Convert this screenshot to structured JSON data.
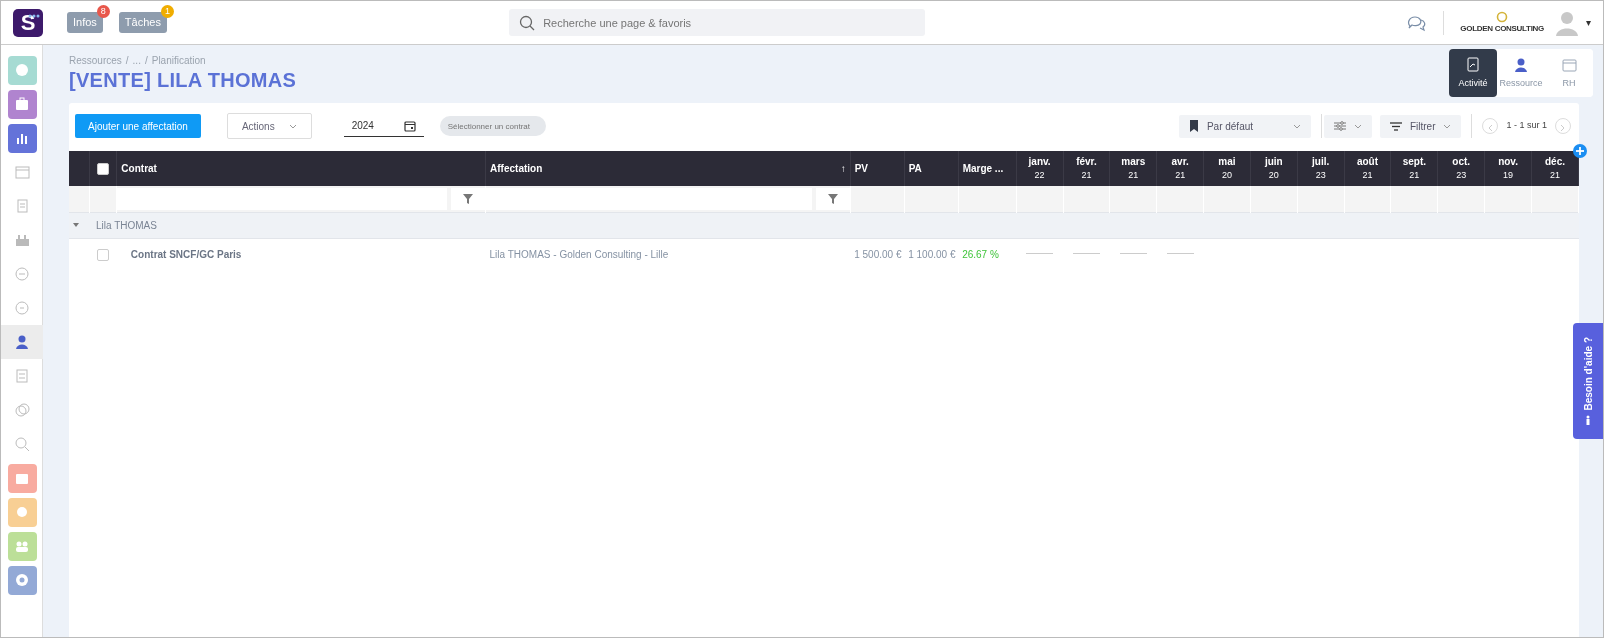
{
  "topbar": {
    "logo_text": "S",
    "badges": [
      {
        "label": "Infos",
        "count": "8",
        "color": "#e8574b"
      },
      {
        "label": "Tâches",
        "count": "1",
        "color": "#f0ad00"
      }
    ],
    "search": {
      "placeholder": "Recherche une page & favoris"
    },
    "company": "GOLDEN CONSULTING",
    "menu_caret": "▾"
  },
  "sidebar": {
    "items": [
      {
        "kind": "tile",
        "color": "#a6dbd3",
        "selected": false
      },
      {
        "kind": "tile",
        "color": "#b084cf",
        "selected": false
      },
      {
        "kind": "tile",
        "color": "#6473d9",
        "selected": false
      },
      {
        "kind": "plain",
        "selected": false
      },
      {
        "kind": "plain",
        "selected": false
      },
      {
        "kind": "plain",
        "selected": false
      },
      {
        "kind": "plain",
        "selected": false
      },
      {
        "kind": "plain",
        "selected": false
      },
      {
        "kind": "plain",
        "selected": true
      },
      {
        "kind": "plain",
        "selected": false
      },
      {
        "kind": "plain",
        "selected": false
      },
      {
        "kind": "plain",
        "selected": false
      },
      {
        "kind": "tile",
        "color": "#f8aba0",
        "selected": false
      },
      {
        "kind": "tile",
        "color": "#f8cf94",
        "selected": false
      },
      {
        "kind": "tile",
        "color": "#bcdf98",
        "selected": false
      },
      {
        "kind": "tile",
        "color": "#93a9d6",
        "selected": false
      }
    ]
  },
  "breadcrumb": [
    "Ressources",
    "/",
    "...",
    "/",
    "Planification"
  ],
  "title": "[VENTE] LILA THOMAS",
  "view_tabs": [
    {
      "label": "Activité",
      "selected": true
    },
    {
      "label": "Ressource",
      "selected": false
    },
    {
      "label": "RH",
      "selected": false
    }
  ],
  "toolbar": {
    "add_button": "Ajouter une affectation",
    "actions": "Actions",
    "year": "2024",
    "contract_select": {
      "placeholder": "Sélectionner un contrat"
    },
    "view_select": "Par défaut",
    "filter_button": "Filtrer",
    "pagination": "1 - 1 sur 1"
  },
  "table": {
    "all_checked": false,
    "columns": [
      {
        "kind": "text",
        "label": "Contrat",
        "filter": true
      },
      {
        "kind": "text",
        "label": "Affectation",
        "filter": true,
        "sort": "↑"
      },
      {
        "kind": "text",
        "label": "PV",
        "filter": false
      },
      {
        "kind": "text",
        "label": "PA",
        "filter": false
      },
      {
        "kind": "text",
        "label": "Marge ...",
        "filter": false
      },
      {
        "kind": "month",
        "label": "janv.",
        "days": "22",
        "filter": false
      },
      {
        "kind": "month",
        "label": "févr.",
        "days": "21",
        "filter": false
      },
      {
        "kind": "month",
        "label": "mars",
        "days": "21",
        "filter": false
      },
      {
        "kind": "month",
        "label": "avr.",
        "days": "21",
        "filter": false
      },
      {
        "kind": "month",
        "label": "mai",
        "days": "20",
        "filter": false
      },
      {
        "kind": "month",
        "label": "juin",
        "days": "20",
        "filter": false
      },
      {
        "kind": "month",
        "label": "juil.",
        "days": "23",
        "filter": false
      },
      {
        "kind": "month",
        "label": "août",
        "days": "21",
        "filter": false
      },
      {
        "kind": "month",
        "label": "sept.",
        "days": "21",
        "filter": false
      },
      {
        "kind": "month",
        "label": "oct.",
        "days": "23",
        "filter": false
      },
      {
        "kind": "month",
        "label": "nov.",
        "days": "19",
        "filter": false
      },
      {
        "kind": "month",
        "label": "déc.",
        "days": "21",
        "filter": false
      }
    ],
    "groups": [
      {
        "label": "Lila THOMAS",
        "expanded": true,
        "rows": [
          {
            "checked": false,
            "contrat": "Contrat SNCF/GC Paris",
            "affectation": "Lila THOMAS - Golden Consulting - Lille",
            "pv": "1 500.00 €",
            "pa": "1 100.00 €",
            "marge": "26.67 %",
            "months": [
              {
                "kind": "input"
              },
              {
                "kind": "input"
              },
              {
                "kind": "input"
              },
              {
                "kind": "input"
              },
              {
                "kind": "empty"
              },
              {
                "kind": "empty"
              },
              {
                "kind": "empty"
              },
              {
                "kind": "empty"
              },
              {
                "kind": "empty"
              },
              {
                "kind": "empty"
              },
              {
                "kind": "empty"
              },
              {
                "kind": "empty"
              }
            ]
          }
        ]
      }
    ]
  },
  "help_tab": "Besoin d'aide ?"
}
